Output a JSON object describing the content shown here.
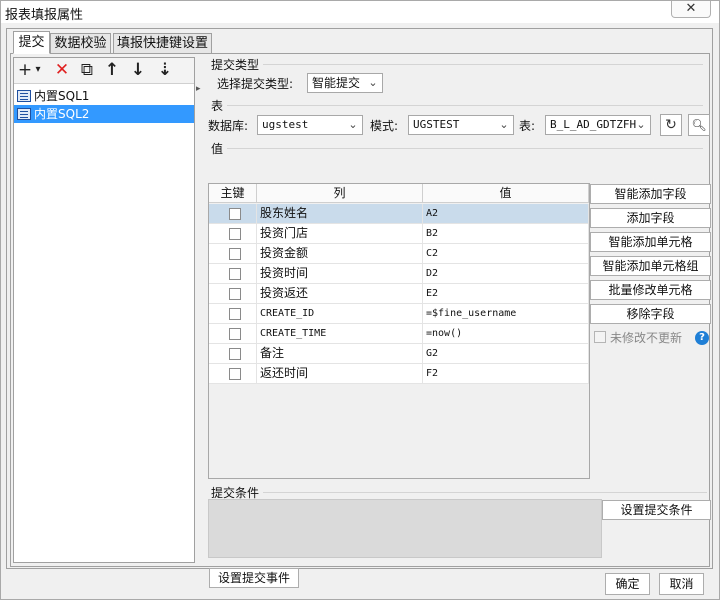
{
  "window": {
    "title": "报表填报属性",
    "close_icon": "✕"
  },
  "tabs": [
    {
      "label": "提交"
    },
    {
      "label": "数据校验"
    },
    {
      "label": "填报快捷键设置"
    }
  ],
  "toolbar": {
    "add": "+",
    "add_dropdown": "▾",
    "delete": "✕",
    "copy": "⧉",
    "move_up": "↑",
    "move_down": "↓",
    "sort": "⇣"
  },
  "tree": {
    "items": [
      {
        "label": "内置SQL1",
        "selected": false
      },
      {
        "label": "内置SQL2",
        "selected": true
      }
    ]
  },
  "submit_type": {
    "section_label": "提交类型",
    "select_label": "选择提交类型:",
    "value": "智能提交"
  },
  "table_section": {
    "section_label": "表",
    "db_label": "数据库:",
    "db_value": "ugstest",
    "schema_label": "模式:",
    "schema_value": "UGSTEST",
    "table_label": "表:",
    "table_value": "B_L_AD_GDTZFH"
  },
  "values": {
    "section_label": "值",
    "headers": {
      "key": "主键",
      "column": "列",
      "value": "值"
    },
    "rows": [
      {
        "column": "股东姓名",
        "value": "A2",
        "mono": false
      },
      {
        "column": "投资门店",
        "value": "B2",
        "mono": false
      },
      {
        "column": "投资金额",
        "value": "C2",
        "mono": false
      },
      {
        "column": "投资时间",
        "value": "D2",
        "mono": false
      },
      {
        "column": "投资返还",
        "value": "E2",
        "mono": false
      },
      {
        "column": "CREATE_ID",
        "value": "=$fine_username",
        "mono": true
      },
      {
        "column": "CREATE_TIME",
        "value": "=now()",
        "mono": true
      },
      {
        "column": "备注",
        "value": "G2",
        "mono": false
      },
      {
        "column": "返还时间",
        "value": "F2",
        "mono": false
      }
    ]
  },
  "side_buttons": {
    "smart_add_field": "智能添加字段",
    "add_field": "添加字段",
    "smart_add_cell": "智能添加单元格",
    "smart_add_cell_group": "智能添加单元格组",
    "batch_modify_cell": "批量修改单元格",
    "remove_field": "移除字段",
    "no_update_label": "未修改不更新",
    "help": "?"
  },
  "condition": {
    "section_label": "提交条件",
    "set_button": "设置提交条件"
  },
  "event_button": "设置提交事件",
  "footer": {
    "ok": "确定",
    "cancel": "取消"
  },
  "colors": {
    "selection": "#3399ff",
    "row_selected": "#c9dbeb",
    "delete_red": "#e02020",
    "help_blue": "#1f7fd6"
  }
}
